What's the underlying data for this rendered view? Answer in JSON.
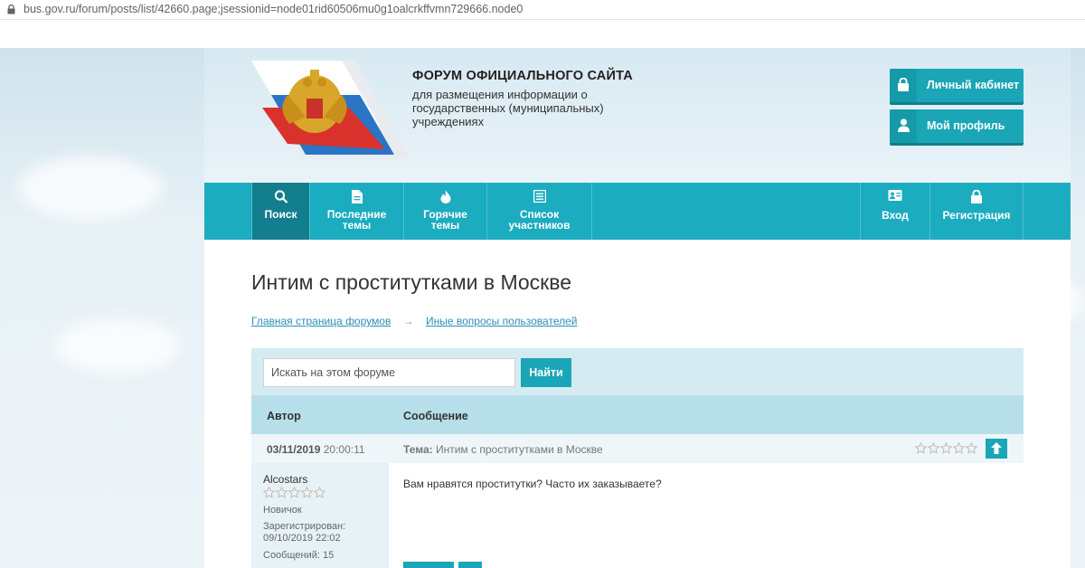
{
  "browser": {
    "url": "bus.gov.ru/forum/posts/list/42660.page;jsessionid=node01rid60506mu0g1oalcrkffvmn729666.node0"
  },
  "header": {
    "title": "ФОРУМ ОФИЦИАЛЬНОГО САЙТА",
    "subtitle": "для размещения информации о государственных (муниципальных) учреждениях",
    "account_button": "Личный кабинет",
    "profile_button": "Мой профиль"
  },
  "nav": {
    "search": "Поиск",
    "latest_line1": "Последние",
    "latest_line2": "темы",
    "hot_line1": "Горячие",
    "hot_line2": "темы",
    "members_line1": "Список",
    "members_line2": "участников",
    "login": "Вход",
    "register": "Регистрация"
  },
  "page": {
    "title": "Интим с проститутками в Москве",
    "breadcrumb": [
      "Главная страница форумов",
      "Иные вопросы пользователей"
    ]
  },
  "search": {
    "placeholder": "Искать на этом форуме",
    "button": "Найти"
  },
  "table": {
    "col_author": "Автор",
    "col_message": "Сообщение"
  },
  "post": {
    "date": "03/11/2019",
    "time": "20:00:11",
    "topic_label": "Тема:",
    "topic": "Интим с проститутками в Москве",
    "author": "Alcostars",
    "rank": "Новичок",
    "registered_label": "Зарегистрирован:",
    "registered": "09/10/2019 22:02",
    "messages": "Сообщений: 15",
    "text": "Вам нравятся проститутки? Часто их заказываете?",
    "rating_stars": 5
  },
  "colors": {
    "accent": "#1aa6b7",
    "nav_bg": "#1cacbf",
    "nav_active": "#137f8e",
    "link": "#2b8fb5"
  }
}
